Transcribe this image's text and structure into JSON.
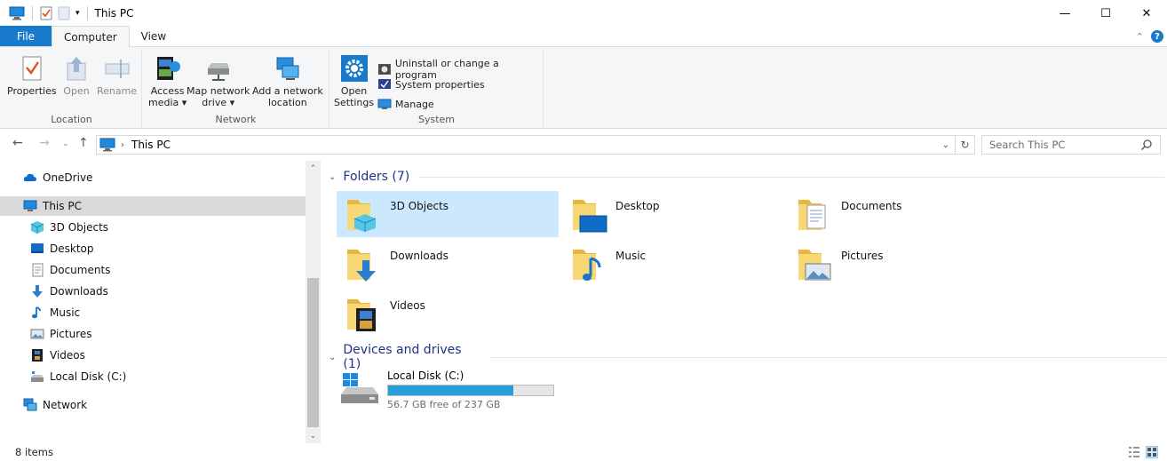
{
  "window": {
    "title": "This PC",
    "minimize": "—",
    "maximize": "☐",
    "close": "✕"
  },
  "ribbon_tabs": [
    {
      "label": "File"
    },
    {
      "label": "Computer"
    },
    {
      "label": "View"
    }
  ],
  "ribbon": {
    "location": {
      "label": "Location",
      "properties": "Properties",
      "open": "Open",
      "rename": "Rename"
    },
    "network": {
      "label": "Network",
      "access_media_1": "Access",
      "access_media_2": "media ▾",
      "map_drive_1": "Map network",
      "map_drive_2": "drive ▾",
      "add_location_1": "Add a network",
      "add_location_2": "location"
    },
    "system": {
      "label": "System",
      "open_settings_1": "Open",
      "open_settings_2": "Settings",
      "uninstall": "Uninstall or change a program",
      "system_properties": "System properties",
      "manage": "Manage"
    }
  },
  "address": {
    "path": "This PC",
    "search_placeholder": "Search This PC"
  },
  "nav_pane": {
    "items": [
      {
        "label": "OneDrive"
      },
      {
        "label": "This PC"
      },
      {
        "label": "3D Objects"
      },
      {
        "label": "Desktop"
      },
      {
        "label": "Documents"
      },
      {
        "label": "Downloads"
      },
      {
        "label": "Music"
      },
      {
        "label": "Pictures"
      },
      {
        "label": "Videos"
      },
      {
        "label": "Local Disk (C:)"
      },
      {
        "label": "Network"
      }
    ]
  },
  "content": {
    "folders_heading": "Folders (7)",
    "folders": [
      {
        "label": "3D Objects"
      },
      {
        "label": "Desktop"
      },
      {
        "label": "Documents"
      },
      {
        "label": "Downloads"
      },
      {
        "label": "Music"
      },
      {
        "label": "Pictures"
      },
      {
        "label": "Videos"
      }
    ],
    "devices_heading": "Devices and drives (1)",
    "drive": {
      "name": "Local Disk (C:)",
      "free": "56.7 GB free of 237 GB",
      "used_fraction": 0.76
    }
  },
  "status": {
    "items": "8 items"
  },
  "colors": {
    "accent": "#1979ca",
    "selection": "#cce8ff",
    "drive_fill": "#26a0da",
    "section_heading": "#1e3287"
  }
}
